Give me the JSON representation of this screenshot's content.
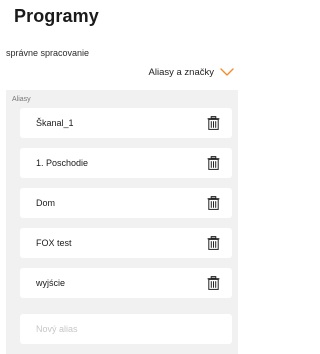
{
  "header": {
    "title": "Programy"
  },
  "subtitle": "správne spracovanie",
  "section": {
    "toggle_label": "Aliasy a značky",
    "toggle_icon": "chevron-down-icon",
    "accent_color": "#f28c28"
  },
  "aliases": {
    "label": "Aliasy",
    "items": [
      {
        "label": "Škanal_1",
        "icon": "trash-icon"
      },
      {
        "label": "1. Poschodie",
        "icon": "trash-icon"
      },
      {
        "label": "Dom",
        "icon": "trash-icon"
      },
      {
        "label": "FOX test",
        "icon": "trash-icon"
      },
      {
        "label": "wyjście",
        "icon": "trash-icon"
      }
    ],
    "new_alias_placeholder": "Nový alias",
    "new_alias_value": ""
  }
}
